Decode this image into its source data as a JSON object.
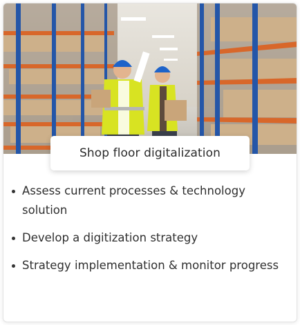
{
  "card": {
    "title": "Shop floor digitalization",
    "photo_subject": "warehouse-workers-photo",
    "bullets": [
      "Assess current processes & technology solution",
      "Develop a digitization strategy",
      "Strategy implementation & monitor progress"
    ]
  },
  "colors": {
    "shelf_orange": "#d8672a",
    "rack_blue": "#2456a8",
    "vest_yellow": "#d8e322",
    "helmet_blue": "#1e63c9",
    "box_cardboard": "#c9a57a"
  }
}
